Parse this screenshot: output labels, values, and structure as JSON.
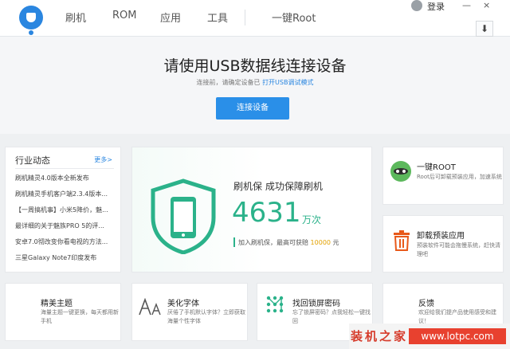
{
  "nav": {
    "items": [
      "刷机",
      "ROM",
      "应用",
      "工具"
    ],
    "root": "一键Root"
  },
  "user": {
    "login": "登录"
  },
  "window": {
    "minimize": "—",
    "close": "×",
    "download": "⬇"
  },
  "connect": {
    "title": "请使用USB数据线连接设备",
    "tip_prefix": "连接前，请确定设备已",
    "tip_link": "打开USB调试模式",
    "button": "连接设备"
  },
  "news": {
    "title": "行业动态",
    "more": "更多>",
    "items": [
      "刷机精灵4.0版本全新发布",
      "刷机精灵手机客户端2.3.4版本...",
      "【一周搞机事】小米5降价，魅...",
      "最详细的关于魅族PRO 5的评...",
      "安卓7.0彻改变你看电视的方法...",
      "三星Galaxy Note7印度发布"
    ]
  },
  "guarantee": {
    "label": "刷机保  成功保障刷机",
    "count": "4631",
    "unit": "万次",
    "footer_prefix": "加入刷机保，最高可获赔",
    "footer_amount": "10000",
    "footer_suffix": "元"
  },
  "services": [
    {
      "title": "一键ROOT",
      "desc": "Root后可卸载预装应用，加速系统"
    },
    {
      "title": "卸载预装应用",
      "desc": "预装软件可能会拖慢系统，赶快清理吧"
    }
  ],
  "features": [
    {
      "title": "精美主题",
      "desc": "海量主题一键更换，每天都用新手机"
    },
    {
      "title": "美化字体",
      "desc": "厌倦了手机默认字体？立即获取海量个性字体"
    },
    {
      "title": "找回锁屏密码",
      "desc": "忘了锁屏密码？点我轻松一键找回"
    },
    {
      "title": "反馈",
      "desc": "欢迎给我们提产品使用感受和建议！"
    }
  ],
  "watermark": {
    "cn": "装机之家",
    "url": "www.lotpc.com"
  },
  "colors": {
    "accent": "#2a8fe8",
    "green": "#2bb28a",
    "orange": "#e2a100"
  }
}
